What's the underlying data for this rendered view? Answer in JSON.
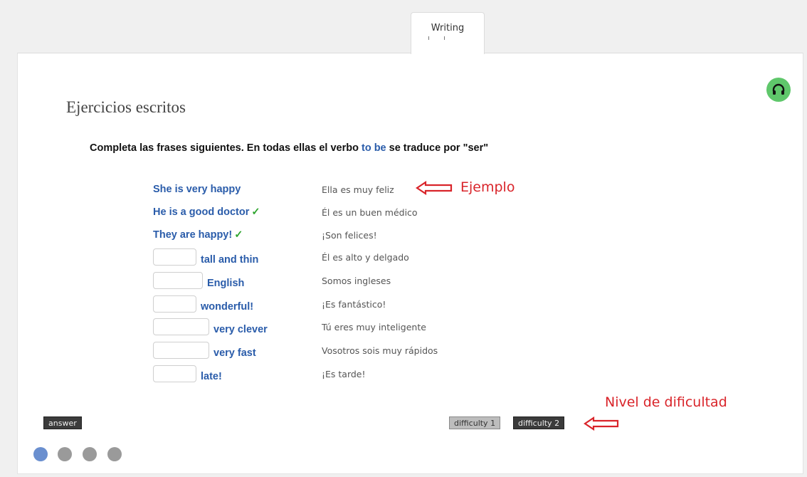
{
  "tab": {
    "label": "Writing"
  },
  "exercise": {
    "title": "Ejercicios escritos",
    "instruction_part1": "Completa las frases siguientes. En todas ellas el verbo ",
    "instruction_highlight": "to be",
    "instruction_part2": " se traduce por \"ser\""
  },
  "rows": [
    {
      "english": "She is very happy",
      "spanish": "Ella es muy feliz"
    },
    {
      "english": "He is a good doctor",
      "check": "✓",
      "spanish": "Él es un buen médico"
    },
    {
      "english": "They are happy!",
      "check": "✓",
      "spanish": "¡Son felices!"
    },
    {
      "blank_value": "",
      "english": "tall and thin",
      "spanish": "Él es alto y delgado"
    },
    {
      "blank_value": "",
      "english": "English",
      "spanish": "Somos ingleses"
    },
    {
      "blank_value": "",
      "english": "wonderful!",
      "spanish": "¡Es fantástico!"
    },
    {
      "blank_value": "",
      "english": "very clever",
      "spanish": "Tú eres muy inteligente"
    },
    {
      "blank_value": "",
      "english": "very fast",
      "spanish": "Vosotros sois muy rápidos"
    },
    {
      "blank_value": "",
      "english": "late!",
      "spanish": "¡Es tarde!"
    }
  ],
  "annotations": {
    "example": "Ejemplo",
    "difficulty_level": "Nivel de dificultad"
  },
  "buttons": {
    "answer": "answer",
    "difficulty1": "difficulty 1",
    "difficulty2": "difficulty 2"
  },
  "pagination": {
    "pages": 4,
    "current": 1
  },
  "colors": {
    "accent_blue": "#2a5caa",
    "check_green": "#2fa52f",
    "annotation_red": "#d9242a",
    "audio_green": "#5fc76b",
    "dot_active": "#6a8fcf",
    "dot_inactive": "#9a9a9a"
  },
  "icons": {
    "audio": "headphones-icon",
    "arrow": "left-arrow-icon"
  }
}
